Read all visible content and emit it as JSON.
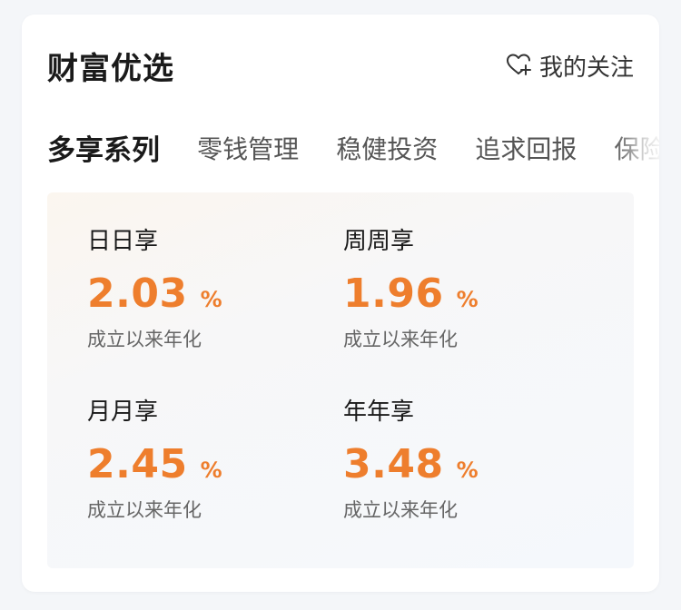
{
  "header": {
    "title": "财富优选",
    "follow_label": "我的关注",
    "follow_icon": "heart-plus-icon"
  },
  "tabs": [
    {
      "label": "多享系列",
      "active": true
    },
    {
      "label": "零钱管理",
      "active": false
    },
    {
      "label": "稳健投资",
      "active": false
    },
    {
      "label": "追求回报",
      "active": false
    },
    {
      "label": "保险",
      "active": false
    }
  ],
  "products": [
    {
      "name": "日日享",
      "rate": "2.03",
      "unit": "%",
      "desc": "成立以来年化"
    },
    {
      "name": "周周享",
      "rate": "1.96",
      "unit": "%",
      "desc": "成立以来年化"
    },
    {
      "name": "月月享",
      "rate": "2.45",
      "unit": "%",
      "desc": "成立以来年化"
    },
    {
      "name": "年年享",
      "rate": "3.48",
      "unit": "%",
      "desc": "成立以来年化"
    }
  ],
  "colors": {
    "accent_rate": "#ee7e2d",
    "title_text": "#1a1a1a",
    "secondary_text": "#666666"
  }
}
